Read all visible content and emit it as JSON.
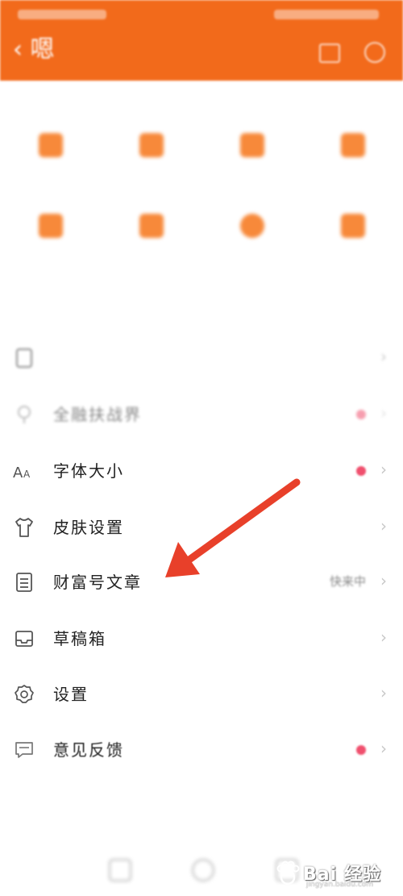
{
  "header": {
    "back_label": "‹ 嗯",
    "accent": "#f26a1b"
  },
  "common_services": {
    "title": "",
    "tiles": [
      {
        "label": ""
      },
      {
        "label": ""
      },
      {
        "label": ""
      },
      {
        "label": ""
      },
      {
        "label": ""
      },
      {
        "label": ""
      },
      {
        "label": ""
      },
      {
        "label": ""
      }
    ]
  },
  "more_settings": {
    "title": "",
    "rows": [
      {
        "label": "",
        "value": "",
        "icon": "tablet-icon"
      },
      {
        "label": "全融扶战界",
        "value": "",
        "icon": "bulb-icon",
        "dot": true
      },
      {
        "label": "字体大小",
        "value": "",
        "icon": "font-size-icon",
        "dot": true
      },
      {
        "label": "皮肤设置",
        "value": "",
        "icon": "shirt-icon"
      },
      {
        "label": "财富号文章",
        "value": "快来中",
        "icon": "document-icon"
      },
      {
        "label": "草稿箱",
        "value": "",
        "icon": "inbox-icon"
      },
      {
        "label": "设置",
        "value": "",
        "icon": "gear-icon"
      },
      {
        "label": "意见反馈",
        "value": "",
        "icon": "feedback-icon",
        "dot": true
      }
    ]
  },
  "logout_label": "",
  "watermark": {
    "text": "Bai 经验",
    "sub": "jingyan.baidu.com"
  },
  "annotation": {
    "arrow_color": "#e8402a"
  },
  "dot_color": "#f0506e"
}
